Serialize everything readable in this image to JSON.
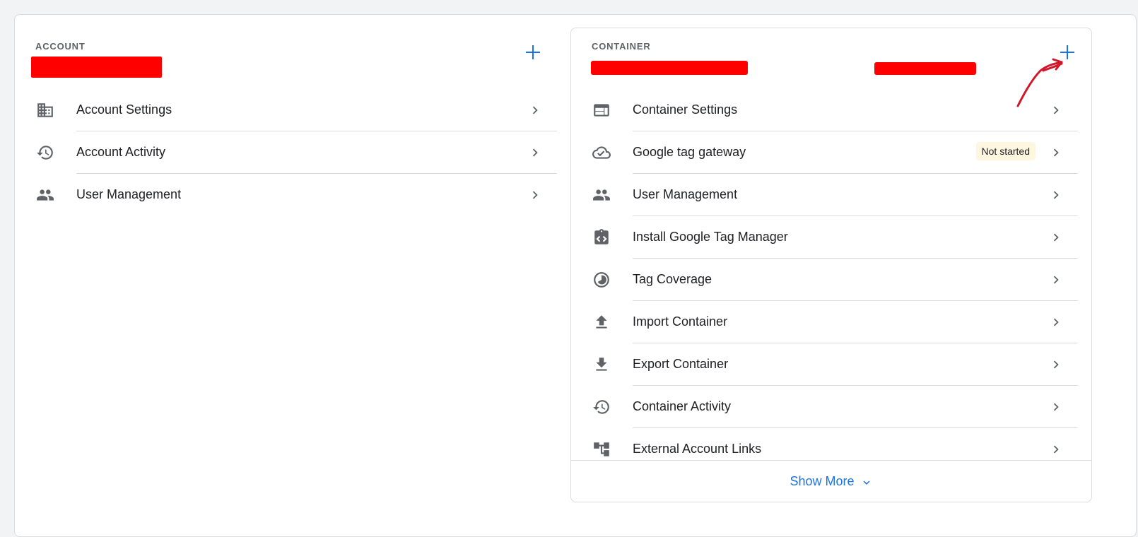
{
  "account": {
    "header_label": "ACCOUNT",
    "add_icon": "plus-icon",
    "items": [
      {
        "label": "Account Settings",
        "icon": "building-icon"
      },
      {
        "label": "Account Activity",
        "icon": "history-icon"
      },
      {
        "label": "User Management",
        "icon": "people-icon"
      }
    ]
  },
  "container": {
    "header_label": "CONTAINER",
    "add_icon": "plus-icon",
    "items": [
      {
        "label": "Container Settings",
        "icon": "web-layout-icon"
      },
      {
        "label": "Google tag gateway",
        "icon": "cloud-check-icon",
        "badge": "Not started"
      },
      {
        "label": "User Management",
        "icon": "people-icon"
      },
      {
        "label": "Install Google Tag Manager",
        "icon": "code-clipboard-icon"
      },
      {
        "label": "Tag Coverage",
        "icon": "coverage-icon"
      },
      {
        "label": "Import Container",
        "icon": "upload-icon"
      },
      {
        "label": "Export Container",
        "icon": "download-icon"
      },
      {
        "label": "Container Activity",
        "icon": "history-icon"
      },
      {
        "label": "External Account Links",
        "icon": "account-tree-icon"
      }
    ],
    "show_more_label": "Show More"
  },
  "colors": {
    "accent": "#1a73e8",
    "redaction": "#ff0000",
    "annotation_arrow": "#d0182a",
    "badge_bg": "#fef7e0"
  }
}
